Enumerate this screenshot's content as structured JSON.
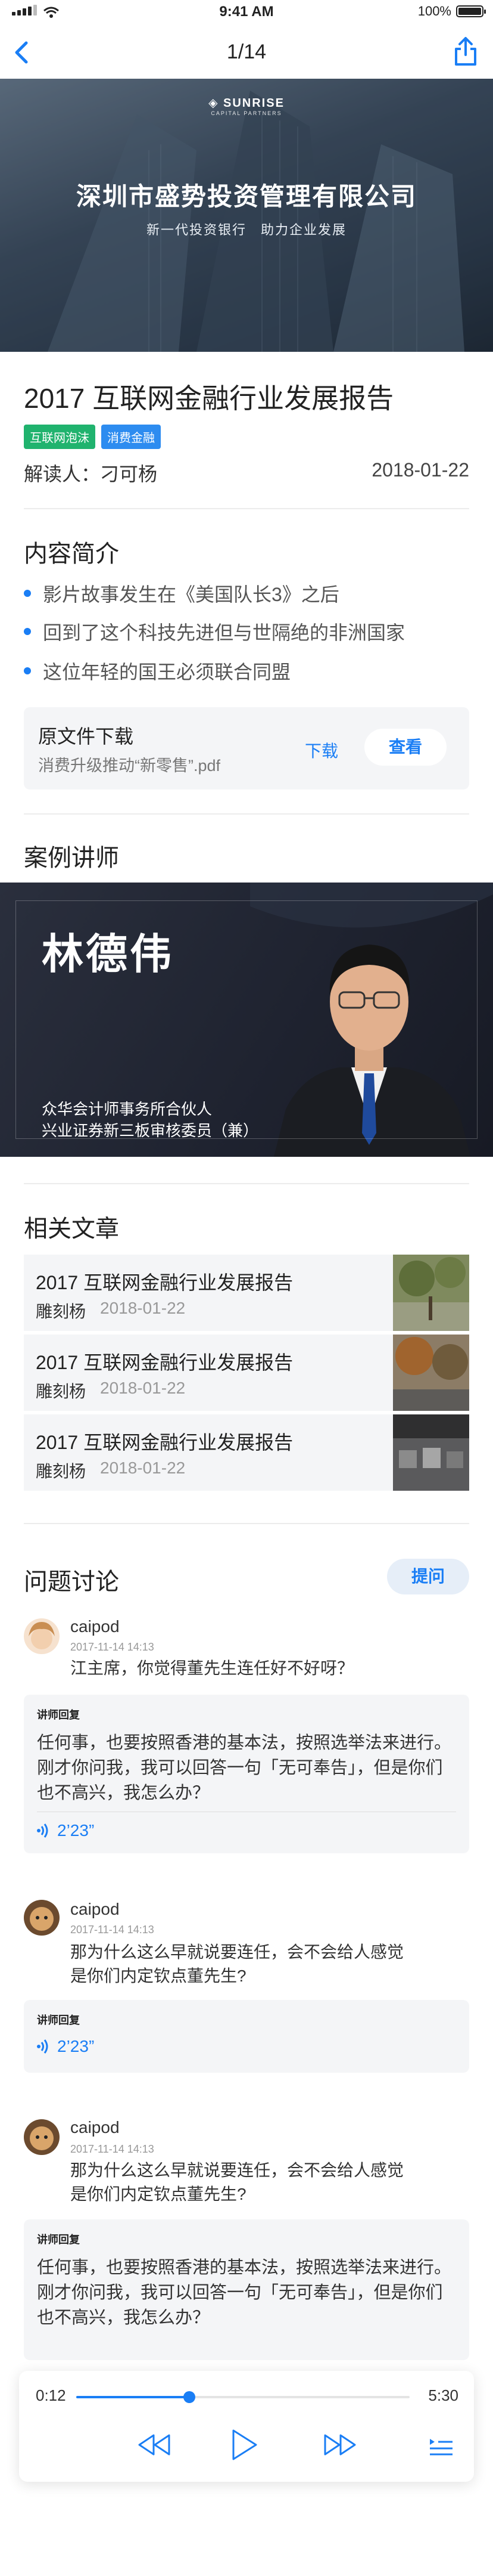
{
  "status_bar": {
    "time": "9:41 AM",
    "battery": "100%"
  },
  "nav": {
    "title": "1/14"
  },
  "banner": {
    "brand": "SUNRISE",
    "brand_sub": "CAPITAL PARTNERS",
    "company": "深圳市盛势投资管理有限公司",
    "slogan": "新一代投资银行　助力企业发展"
  },
  "article": {
    "title": "2017 互联网金融行业发展报告",
    "tags": [
      {
        "label": "互联网泡沫",
        "color": "#20b36e"
      },
      {
        "label": "消费金融",
        "color": "#2d8cf0"
      }
    ],
    "reader": "解读人：刁可杨",
    "date": "2018-01-22"
  },
  "intro": {
    "title": "内容简介",
    "items": [
      "影片故事发生在《美国队长3》之后",
      "回到了这个科技先进但与世隔绝的非洲国家",
      "这位年轻的国王必须联合同盟"
    ]
  },
  "download": {
    "title": "原文件下载",
    "file": "消费升级推动“新零售”.pdf",
    "download_label": "下载",
    "view_label": "查看"
  },
  "lecturer": {
    "section_title": "案例讲师",
    "name": "林德伟",
    "role1": "众华会计师事务所合伙人",
    "role2": "兴业证券新三板审核委员（兼）"
  },
  "related": {
    "title": "相关文章",
    "items": [
      {
        "title": "2017 互联网金融行业发展报告",
        "author": "雕刻杨",
        "date": "2018-01-22"
      },
      {
        "title": "2017 互联网金融行业发展报告",
        "author": "雕刻杨",
        "date": "2018-01-22"
      },
      {
        "title": "2017 互联网金融行业发展报告",
        "author": "雕刻杨",
        "date": "2018-01-22"
      }
    ]
  },
  "discussion": {
    "title": "问题讨论",
    "ask_label": "提问",
    "reply_label": "讲师回复",
    "comments": [
      {
        "user": "caipod",
        "time": "2017-11-14 14:13",
        "text": "江主席，你觉得董先生连任好不好呀？",
        "reply_text": "任何事，也要按照香港的基本法，按照选举法来进行。刚才你问我，我可以回答一句「无可奉告」，但是你们也不高兴，我怎么办？",
        "audio": "2’23”"
      },
      {
        "user": "caipod",
        "time": "2017-11-14 14:13",
        "text": "那为什么这么早就说要连任，会不会给人感觉是你们内定钦点董先生?",
        "audio": "2’23”"
      },
      {
        "user": "caipod",
        "time": "2017-11-14 14:13",
        "text": "那为什么这么早就说要连任，会不会给人感觉是你们内定钦点董先生?",
        "reply_text": "任何事，也要按照香港的基本法，按照选举法来进行。刚才你问我，我可以回答一句「无可奉告」，但是你们也不高兴，我怎么办？"
      }
    ]
  },
  "player": {
    "current": "0:12",
    "total": "5:30",
    "progress": 0.34,
    "accent": "#1a7ef5"
  }
}
